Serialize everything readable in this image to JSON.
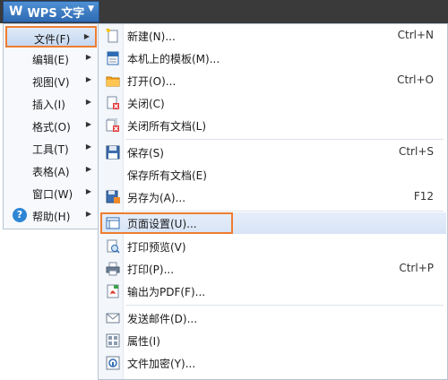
{
  "app": {
    "title": "WPS 文字",
    "logo": "W"
  },
  "menu": [
    {
      "label": "文件(F)",
      "active": true
    },
    {
      "label": "编辑(E)"
    },
    {
      "label": "视图(V)"
    },
    {
      "label": "插入(I)"
    },
    {
      "label": "格式(O)"
    },
    {
      "label": "工具(T)"
    },
    {
      "label": "表格(A)"
    },
    {
      "label": "窗口(W)"
    },
    {
      "label": "帮助(H)",
      "icon": "help-icon"
    }
  ],
  "submenu": [
    {
      "label": "新建(N)...",
      "shortcut": "Ctrl+N",
      "icon": "new-document-icon"
    },
    {
      "label": "本机上的模板(M)...",
      "shortcut": "",
      "icon": "template-icon"
    },
    {
      "label": "打开(O)...",
      "shortcut": "Ctrl+O",
      "icon": "open-folder-icon"
    },
    {
      "label": "关闭(C)",
      "shortcut": "",
      "icon": "close-document-icon"
    },
    {
      "label": "关闭所有文档(L)",
      "shortcut": "",
      "icon": "close-all-icon"
    },
    {
      "label": "保存(S)",
      "shortcut": "Ctrl+S",
      "icon": "save-icon"
    },
    {
      "label": "保存所有文档(E)",
      "shortcut": "",
      "icon": ""
    },
    {
      "label": "另存为(A)...",
      "shortcut": "F12",
      "icon": "save-as-icon"
    },
    {
      "label": "页面设置(U)...",
      "shortcut": "",
      "icon": "page-setup-icon"
    },
    {
      "label": "打印预览(V)",
      "shortcut": "",
      "icon": "print-preview-icon"
    },
    {
      "label": "打印(P)...",
      "shortcut": "Ctrl+P",
      "icon": "print-icon"
    },
    {
      "label": "输出为PDF(F)...",
      "shortcut": "",
      "icon": "pdf-icon"
    },
    {
      "label": "发送邮件(D)...",
      "shortcut": "",
      "icon": "mail-icon"
    },
    {
      "label": "属性(I)",
      "shortcut": "",
      "icon": "properties-icon"
    },
    {
      "label": "文件加密(Y)...",
      "shortcut": "",
      "icon": "encrypt-icon"
    }
  ],
  "colors": {
    "highlight_box": "#ee7d30",
    "title_bar": "#3a3a3a",
    "wps_button": "#2f6bb3"
  }
}
